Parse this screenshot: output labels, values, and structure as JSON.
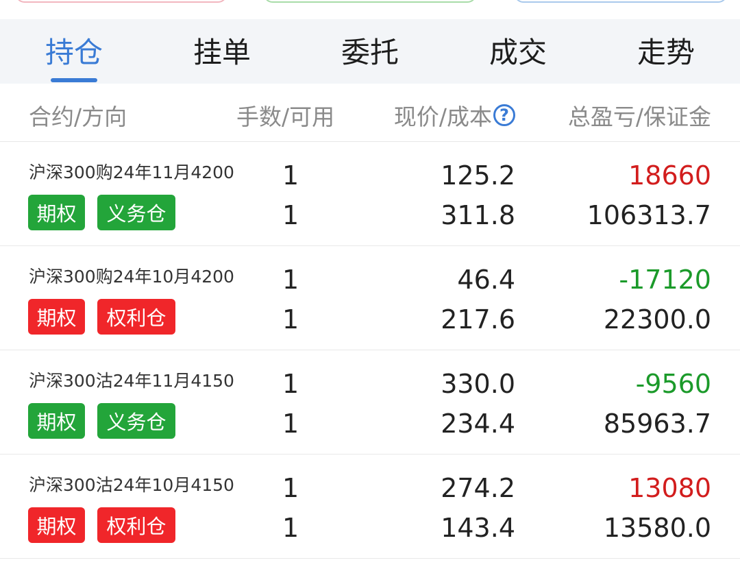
{
  "tabs": [
    "持仓",
    "挂单",
    "委托",
    "成交",
    "走势"
  ],
  "active_tab": "持仓",
  "columns": {
    "contract": "合约/方向",
    "qty": "手数/可用",
    "price": "现价/成本",
    "pnl": "总盈亏/保证金"
  },
  "positions": [
    {
      "name": "沪深300购24年11月4200",
      "tag1": "期权",
      "tag2": "义务仓",
      "tag_color": "#23a53a",
      "qty": "1",
      "available": "1",
      "current_price": "125.2",
      "cost": "311.8",
      "total_pnl": "18660",
      "margin": "106313.7",
      "pnl_color": "#d21d1d"
    },
    {
      "name": "沪深300购24年10月4200",
      "tag1": "期权",
      "tag2": "权利仓",
      "tag_color": "#f0262a",
      "qty": "1",
      "available": "1",
      "current_price": "46.4",
      "cost": "217.6",
      "total_pnl": "-17120",
      "margin": "22300.0",
      "pnl_color": "#1b9a2a"
    },
    {
      "name": "沪深300沽24年11月4150",
      "tag1": "期权",
      "tag2": "义务仓",
      "tag_color": "#23a53a",
      "qty": "1",
      "available": "1",
      "current_price": "330.0",
      "cost": "234.4",
      "total_pnl": "-9560",
      "margin": "85963.7",
      "pnl_color": "#1b9a2a"
    },
    {
      "name": "沪深300沽24年10月4150",
      "tag1": "期权",
      "tag2": "权利仓",
      "tag_color": "#f0262a",
      "qty": "1",
      "available": "1",
      "current_price": "274.2",
      "cost": "143.4",
      "total_pnl": "13080",
      "margin": "13580.0",
      "pnl_color": "#d21d1d"
    }
  ]
}
